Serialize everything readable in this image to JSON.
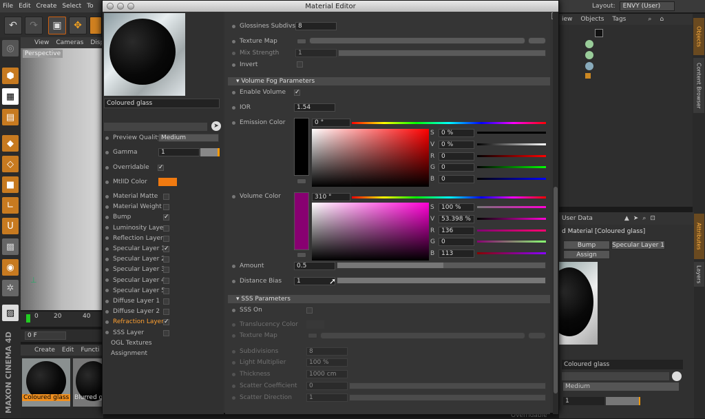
{
  "app": {
    "menu": [
      "File",
      "Edit",
      "Create",
      "Select",
      "To"
    ],
    "viewport_menu": [
      "View",
      "Cameras",
      "Disp"
    ],
    "viewport_label": "Perspective",
    "timeline": {
      "ticks": [
        "0",
        "20",
        "40"
      ],
      "frame_field": "0 F"
    },
    "material_manager_menu": [
      "Create",
      "Edit",
      "Functi"
    ],
    "materials": [
      "Coloured glass",
      "Blurred g"
    ],
    "logo": "MAXON CINEMA 4D"
  },
  "right": {
    "layout_label": "Layout:",
    "layout_value": "ENVY (User)",
    "obj_tabs": [
      "iew",
      "Objects",
      "Tags"
    ],
    "side_tabs": [
      "Objects",
      "Content Browser",
      "Attributes",
      "Layers"
    ],
    "attr_title": "User Data",
    "attr_subtitle": "d Material [Coloured glass]",
    "attr_buttons": [
      "Bump",
      "Specular Layer 1",
      "Assign"
    ],
    "attr_name": "Coloured glass",
    "attr_quality": "Medium",
    "attr_gamma": "1",
    "bottom_hint": "Overridable"
  },
  "editor": {
    "title": "Material Editor",
    "material_name": "Coloured glass",
    "left": {
      "preview_quality_label": "Preview Quality",
      "preview_quality": "Medium",
      "gamma_label": "Gamma",
      "gamma_value": "1",
      "overridable_label": "Overridable",
      "mtlid_label": "MtlID Color",
      "mtlid_color": "#f07a10",
      "channels": [
        {
          "label": "Material Matte",
          "checked": false,
          "active": false
        },
        {
          "label": "Material Weight",
          "checked": false,
          "active": false
        },
        {
          "label": "Bump",
          "checked": true,
          "active": false
        },
        {
          "label": "Luminosity Layer",
          "checked": false,
          "active": false
        },
        {
          "label": "Reflection Layer",
          "checked": false,
          "active": false
        },
        {
          "label": "Specular Layer 1",
          "checked": true,
          "active": false
        },
        {
          "label": "Specular Layer 2",
          "checked": false,
          "active": false
        },
        {
          "label": "Specular Layer 3",
          "checked": false,
          "active": false
        },
        {
          "label": "Specular Layer 4",
          "checked": false,
          "active": false
        },
        {
          "label": "Specular Layer 5",
          "checked": false,
          "active": false
        },
        {
          "label": "Diffuse Layer 1",
          "checked": false,
          "active": false
        },
        {
          "label": "Diffuse Layer 2",
          "checked": false,
          "active": false
        },
        {
          "label": "Refraction Layer",
          "checked": true,
          "active": true
        },
        {
          "label": "SSS Layer",
          "checked": false,
          "active": false
        }
      ],
      "ogl_textures": "OGL Textures",
      "assignment": "Assignment"
    },
    "top_rows": {
      "glossiness_subdivs_label": "Glossines Subdivs",
      "glossiness_subdivs_value": "8",
      "texture_map_label": "Texture Map",
      "mix_strength_label": "Mix Strength",
      "mix_strength_value": "1",
      "invert_label": "Invert"
    },
    "volume_fog": {
      "header": "Volume Fog Parameters",
      "enable_volume_label": "Enable Volume",
      "ior_label": "IOR",
      "ior_value": "1.54",
      "emission_label": "Emission Color",
      "emission": {
        "hue": "0 °",
        "S": "0 %",
        "V": "0 %",
        "R": "0",
        "G": "0",
        "B": "0",
        "swatch": "#000000"
      },
      "volume_label": "Volume Color",
      "volume": {
        "hue": "310 °",
        "S": "100 %",
        "V": "53.398 %",
        "R": "136",
        "G": "0",
        "B": "113",
        "swatch": "#880071"
      },
      "amount_label": "Amount",
      "amount_value": "0.5",
      "distance_bias_label": "Distance Bias",
      "distance_bias_value": "1"
    },
    "sss": {
      "header": "SSS Parameters",
      "rows": [
        {
          "label": "SSS On",
          "value": ""
        },
        {
          "label": "Translucency Color",
          "value": ""
        },
        {
          "label": "Texture Map",
          "value": ""
        },
        {
          "label": "Subdivisions",
          "value": "8"
        },
        {
          "label": "Light Multiplier",
          "value": "100 %"
        },
        {
          "label": "Thickness",
          "value": "1000 cm"
        },
        {
          "label": "Scatter Coefficient",
          "value": "0"
        },
        {
          "label": "Scatter Direction",
          "value": "1"
        }
      ]
    },
    "channel_letters": [
      "S",
      "V",
      "R",
      "G",
      "B"
    ]
  }
}
